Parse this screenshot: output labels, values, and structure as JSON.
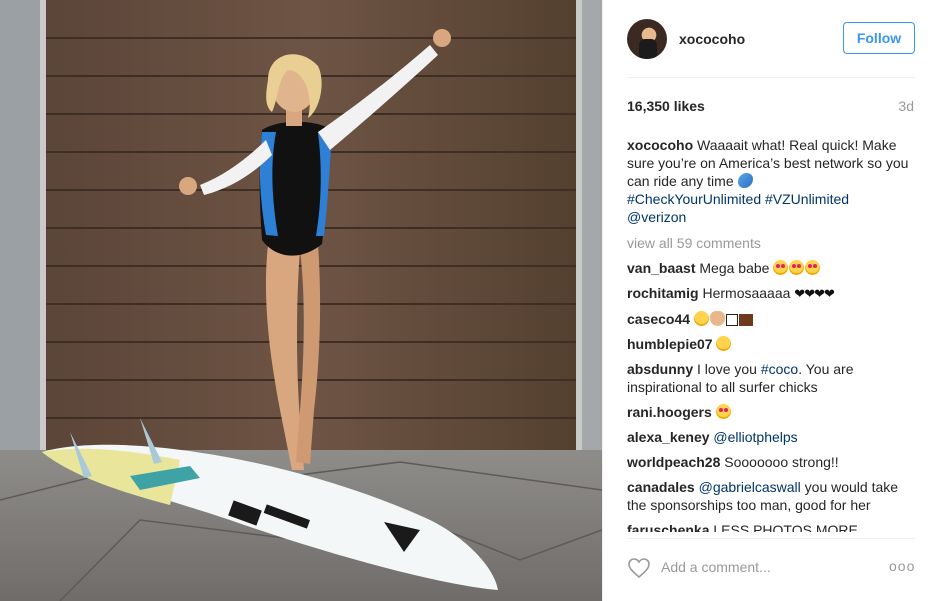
{
  "post": {
    "username": "xococoho",
    "follow_label": "Follow",
    "likes": "16,350 likes",
    "time": "3d",
    "caption": {
      "user": "xococoho",
      "text": "Waaaait what! Real quick! Make sure you’re on America’s best network so you can ride any time",
      "tags": [
        "#CheckYourUnlimited",
        "#VZUnlimited"
      ],
      "mention": "@verizon"
    },
    "view_all": "view all 59 comments",
    "comments": [
      {
        "user": "van_baast",
        "text": "Mega babe"
      },
      {
        "user": "rochitamig",
        "text": "Hermosaaaaa"
      },
      {
        "user": "caseco44",
        "text": ""
      },
      {
        "user": "humblepie07",
        "text": ""
      },
      {
        "user": "absdunny",
        "text_before": "I love you",
        "tag": "#coco",
        "text_after": ". You are inspirational to all surfer chicks"
      },
      {
        "user": "rani.hoogers",
        "text": ""
      },
      {
        "user": "alexa_keney",
        "mention": "@elliotphelps"
      },
      {
        "user": "worldpeach28",
        "text": "Sooooooo strong!!"
      },
      {
        "user": "canadales",
        "mention": "@gabrielcaswall",
        "text": "you would take the sponsorships too man, good for her"
      },
      {
        "user": "faruschenka",
        "text": "LESS PHOTOS MORE"
      }
    ],
    "add_comment_placeholder": "Add a comment...",
    "more_label": "ooo"
  },
  "colors": {
    "link": "#003569",
    "follow_blue": "#3897f0",
    "muted": "#999999",
    "text": "#262626"
  },
  "icons": [
    "heart-outline-icon",
    "more-options-icon"
  ]
}
